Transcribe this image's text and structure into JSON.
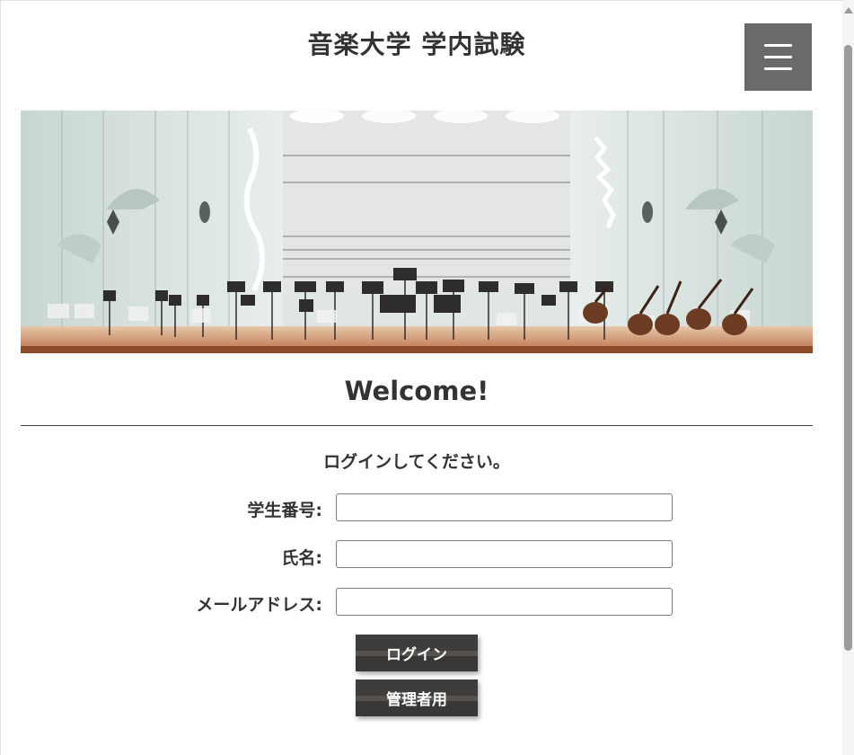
{
  "header": {
    "site_title": "音楽大学 学内試験",
    "menu_icon": "hamburger-icon"
  },
  "hero": {
    "image_subject": "concert-hall-stage"
  },
  "main": {
    "welcome_heading": "Welcome!",
    "instruction": "ログインしてください。",
    "fields": [
      {
        "label": "学生番号:",
        "value": "",
        "placeholder": ""
      },
      {
        "label": "氏名:",
        "value": "",
        "placeholder": ""
      },
      {
        "label": "メールアドレス:",
        "value": "",
        "placeholder": ""
      }
    ],
    "login_button": "ログイン",
    "admin_button": "管理者用"
  },
  "colors": {
    "menu_button_bg": "#6b6a69",
    "button_bg": "#3f3d3c",
    "text": "#333333"
  }
}
